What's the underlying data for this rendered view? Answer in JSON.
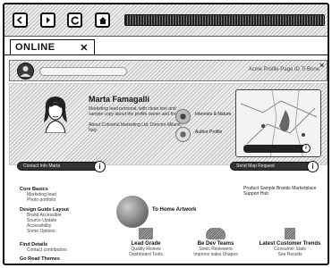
{
  "browser": {
    "tab_label": "ONLINE",
    "tab_close": "✕",
    "icons": {
      "back": "back-icon",
      "forward": "forward-icon",
      "reload": "reload-icon",
      "home": "home-icon"
    }
  },
  "banner": {
    "text": "Acme Profile Page ID Ti Bone",
    "close": "✕"
  },
  "profile": {
    "name": "Marta Famagalli",
    "bio": "Marketing lead personal, with clean text and sample copy about the profile owner and focus.",
    "contact": "About Colourful Marketing Ltd, Director Milano, Italy",
    "badges": [
      {
        "label": "Interests & Nature"
      },
      {
        "label": "Author Profile"
      }
    ]
  },
  "bars": {
    "left_label": "Contact Info Marta",
    "right_label": "Send Map Request",
    "info_symbol": "i"
  },
  "sidebar": {
    "sections": [
      {
        "title": "Core Basics",
        "items": [
          "Marketing lead",
          "Photo portfolio"
        ]
      },
      {
        "title": "Design Guide Layout",
        "items": [
          "Brand Accessible",
          "Source Update",
          "Accessibility",
          "Some Options"
        ]
      },
      {
        "title": "Find Details",
        "items": [
          "Contact contributors"
        ]
      },
      {
        "title": "Go Read Themes",
        "items": []
      }
    ]
  },
  "main": {
    "caption": "Product Sample Brands Marketplace Support Hub",
    "feature": "To Home Artwork",
    "columns": [
      {
        "title": "Lead Grade",
        "lines": [
          "Quality Review",
          "Dashboard Tools"
        ]
      },
      {
        "title": "Be Dev Teams",
        "lines": [
          "Sonic Reviewers",
          "Improve sales Shapes"
        ]
      },
      {
        "title": "Latest Customer Trends",
        "lines": [
          "Consumer Stats",
          "See Results"
        ]
      }
    ],
    "icons": {
      "feature": "globe-icon",
      "col1": "speech-bubble-icon",
      "col2": "cloud-icon",
      "col3": "chart-icon"
    }
  }
}
